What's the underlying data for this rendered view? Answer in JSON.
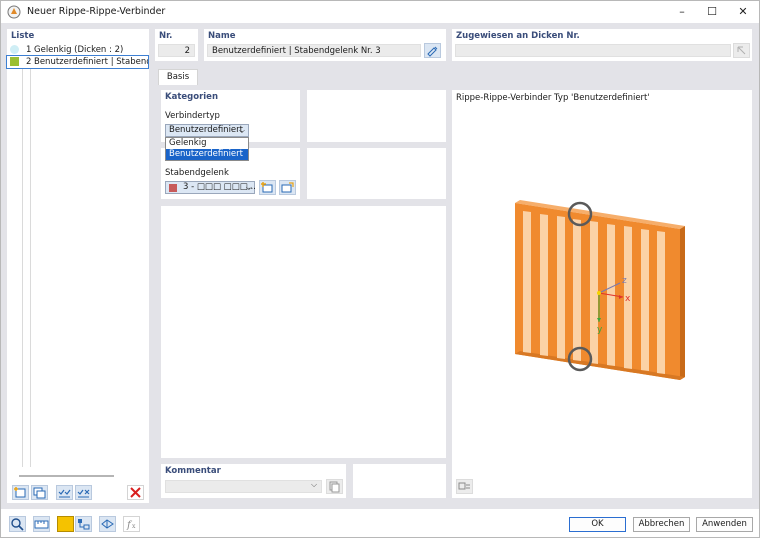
{
  "window": {
    "title": "Neuer Rippe-Rippe-Verbinder",
    "min_glyph": "–",
    "max_glyph": "☐",
    "close_glyph": "✕"
  },
  "list": {
    "caption": "Liste",
    "items": [
      {
        "nr": "1",
        "label": "Gelenkig (Dicken : 2)",
        "color": "#cfeef5"
      },
      {
        "nr": "2",
        "label": "Benutzerdefiniert | Stabendgelenk",
        "color": "#9bbf32"
      }
    ]
  },
  "nr": {
    "caption": "Nr.",
    "value": "2"
  },
  "name": {
    "caption": "Name",
    "value": "Benutzerdefiniert | Stabendgelenk Nr. 3"
  },
  "assigned": {
    "caption": "Zugewiesen an Dicken Nr.",
    "value": ""
  },
  "tabs": [
    {
      "label": "Basis"
    }
  ],
  "categories": {
    "caption": "Kategorien",
    "connector_type_label": "Verbindertyp",
    "connector_type_value": "Benutzerdefiniert",
    "options": [
      "Gelenkig",
      "Benutzerdefiniert"
    ],
    "end_release_label": "Stabendgelenk",
    "end_release_value": "3 - □□□ □□□..."
  },
  "preview": {
    "caption": "Rippe-Rippe-Verbinder Typ 'Benutzerdefiniert'",
    "axis_x": "x",
    "axis_y": "y",
    "axis_z": "z"
  },
  "comment": {
    "caption": "Kommentar",
    "value": ""
  },
  "buttons": {
    "ok": "OK",
    "cancel": "Abbrechen",
    "apply": "Anwenden"
  },
  "icons": {
    "list_toolbar": [
      "new-item-icon",
      "copy-item-icon",
      "check-all-icon",
      "uncheck-icon",
      "delete-icon"
    ],
    "footer": [
      "search-icon",
      "units-icon",
      "color-icon",
      "structure-icon",
      "view-icon",
      "formula-icon"
    ]
  },
  "colors": {
    "accent": "#3d7fd2",
    "caption": "#3a4d7a",
    "wood": "#f08a2e",
    "wood_light": "#fbd2a6",
    "delete": "#d81e1e",
    "footer_color_swatch": "#f5c200"
  }
}
